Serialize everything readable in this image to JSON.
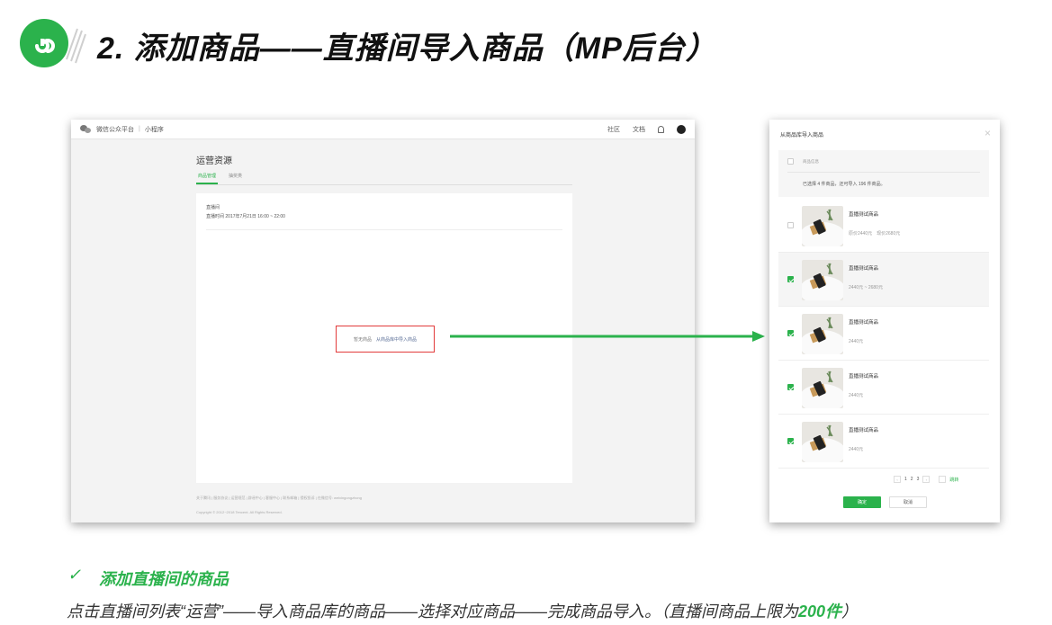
{
  "header": {
    "title": "2. 添加商品——直播间导入商品（MP后台）"
  },
  "screenshot": {
    "brand": "微信公众平台",
    "brand_sub": "小程序",
    "nav": [
      "社区",
      "文档"
    ],
    "section_title": "运营资源",
    "tabs": [
      "商品管理",
      "抽奖类"
    ],
    "card_label": "直播间",
    "card_time": "直播时间 2017年7月21日 16:00 ~ 22:00",
    "empty_text": "暂无商品",
    "import_link": "从商品库中导入商品",
    "footer_links": "关于腾讯 | 服务协议 | 运营规范 | 辟谣中心 | 客服中心 | 联系邮箱 | 侵权投诉 | 在微信号: weixingongzhong",
    "footer_copy": "Copyright © 2012~2018 Tencent. All Rights Reserved."
  },
  "modal": {
    "title": "从商品库导入商品",
    "header_label": "商品信息",
    "info": "已选择 4 件商品，还可导入 196 件商品。",
    "products": [
      {
        "name": "直播测试商品",
        "price": "原价2440元　现价2680元",
        "checked": false
      },
      {
        "name": "直播测试商品",
        "price": "2440元 ~ 2680元",
        "checked": true
      },
      {
        "name": "直播测试商品",
        "price": "2440元",
        "checked": true
      },
      {
        "name": "直播测试商品",
        "price": "2440元",
        "checked": true
      },
      {
        "name": "直播测试商品",
        "price": "2440元",
        "checked": true
      }
    ],
    "pages": [
      "1",
      "2",
      "3"
    ],
    "jump_label": "跳转",
    "confirm": "确定",
    "cancel": "取消"
  },
  "bottom": {
    "check": "✓",
    "heading": "添加直播间的商品",
    "desc": "点击直播间列表“运营”——导入商品库的商品——选择对应商品——完成商品导入。（直播间商品上限为",
    "desc_em": "200件",
    "desc_end": "）"
  },
  "colors": {
    "accent": "#2bb24c",
    "highlight_border": "#e23b3b",
    "link": "#576b95"
  }
}
